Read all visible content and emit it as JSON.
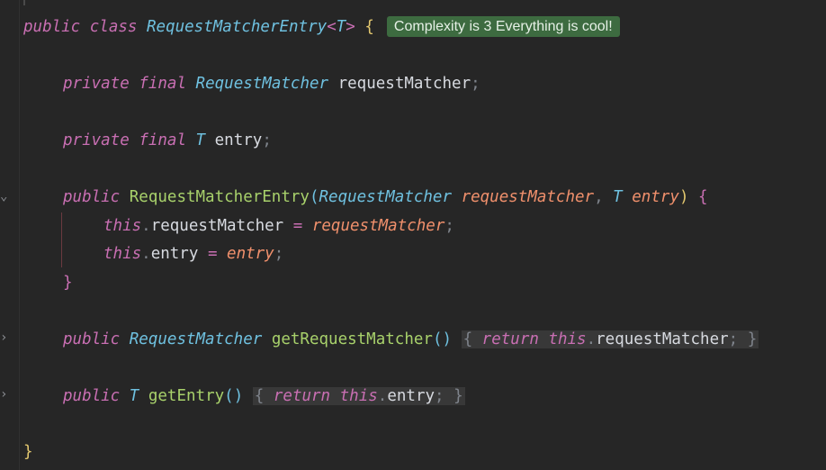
{
  "code": {
    "class_line": {
      "public": "public",
      "class": "class",
      "name": "RequestMatcherEntry",
      "generic_open": "<",
      "generic_t": "T",
      "generic_close": ">",
      "brace": "{",
      "hint": "Complexity is 3 Everything is cool!"
    },
    "field1": {
      "private": "private",
      "final": "final",
      "type": "RequestMatcher",
      "name": "requestMatcher",
      "semi": ";"
    },
    "field2": {
      "private": "private",
      "final": "final",
      "type": "T",
      "name": "entry",
      "semi": ";"
    },
    "ctor": {
      "public": "public",
      "name": "RequestMatcherEntry",
      "paren_open": "(",
      "p1_type": "RequestMatcher",
      "p1_name": "requestMatcher",
      "comma": ",",
      "p2_type": "T",
      "p2_name": "entry",
      "paren_close": ")",
      "brace": "{"
    },
    "assign1": {
      "this": "this",
      "dot": ".",
      "field": "requestMatcher",
      "eq": "=",
      "value": "requestMatcher",
      "semi": ";"
    },
    "assign2": {
      "this": "this",
      "dot": ".",
      "field": "entry",
      "eq": "=",
      "value": "entry",
      "semi": ";"
    },
    "ctor_close": "}",
    "getter1": {
      "public": "public",
      "type": "RequestMatcher",
      "name": "getRequestMatcher",
      "parens": "()",
      "open": "{",
      "return": "return",
      "this": "this",
      "dot": ".",
      "field": "requestMatcher",
      "semi": ";",
      "close": "}"
    },
    "getter2": {
      "public": "public",
      "type": "T",
      "name": "getEntry",
      "parens": "()",
      "open": "{",
      "return": "return",
      "this": "this",
      "dot": ".",
      "field": "entry",
      "semi": ";",
      "close": "}"
    },
    "class_close": "}"
  },
  "gutter": {
    "fold_expanded_icon": "chevron-down-icon",
    "fold_collapsed_icon": "chevron-right-icon"
  },
  "colors": {
    "background": "#262626",
    "keyword": "#c96fb3",
    "type": "#6fc1e0",
    "function": "#a8d16b",
    "parameter": "#f0906c",
    "hint_background": "#3d6b40"
  }
}
